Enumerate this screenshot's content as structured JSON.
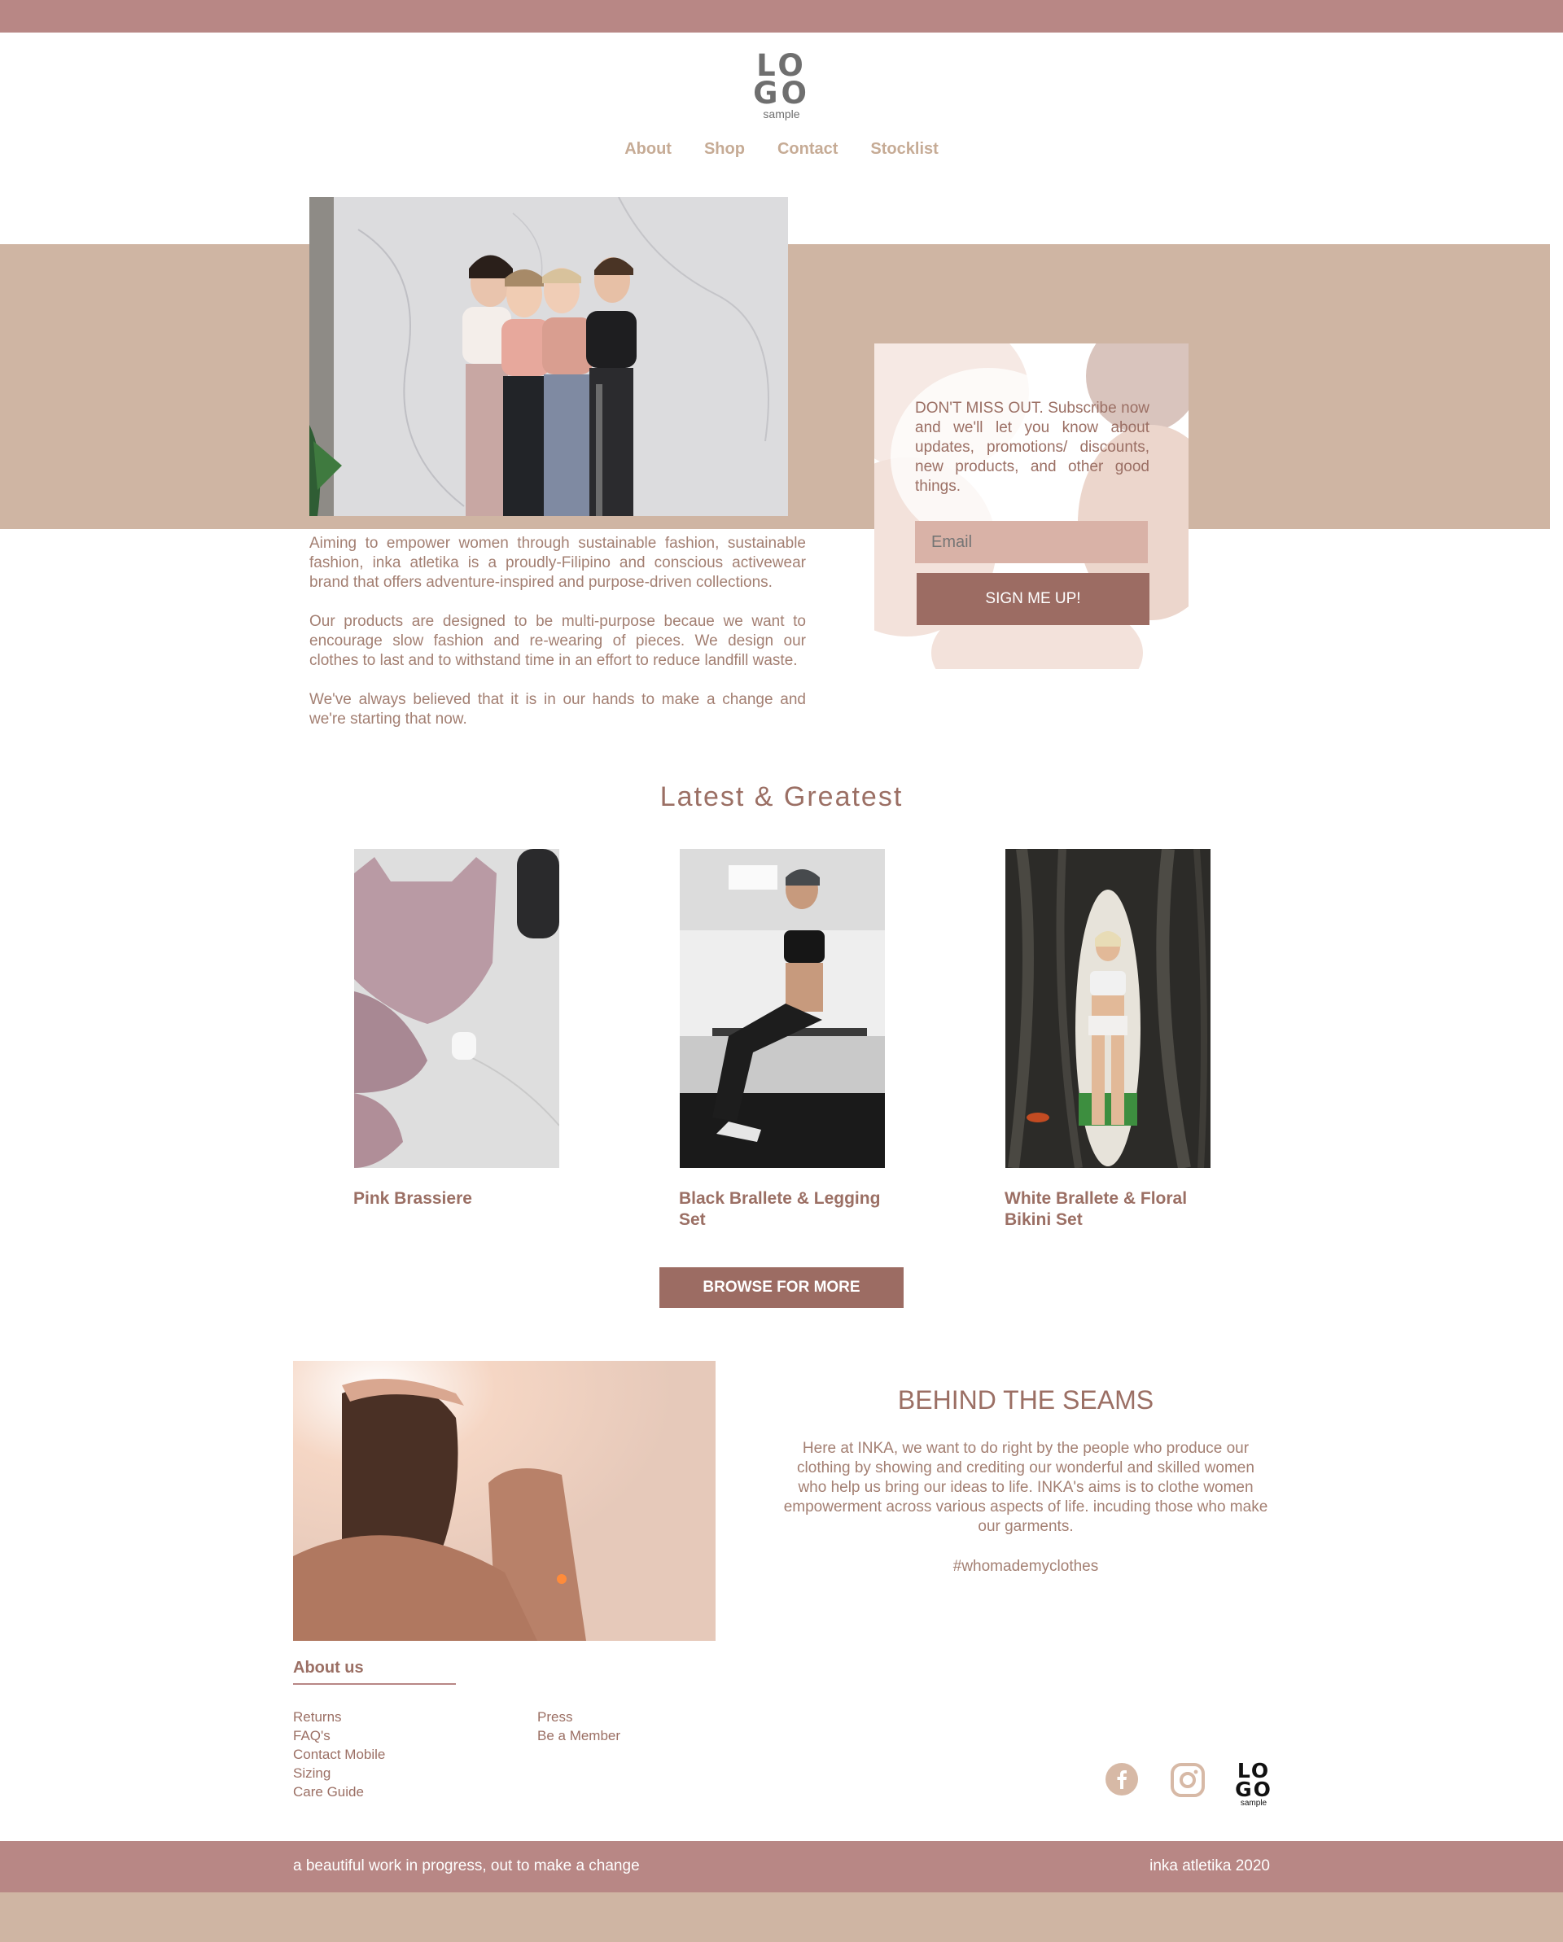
{
  "brand": {
    "logo_line1": "LO",
    "logo_line2": "GO",
    "logo_sub": "sample"
  },
  "nav": {
    "items": [
      {
        "label": "About"
      },
      {
        "label": "Shop"
      },
      {
        "label": "Contact"
      },
      {
        "label": "Stocklist"
      }
    ]
  },
  "newsletter": {
    "text": "DON'T MISS OUT. Subscribe now and we'll let you know about updates, promotions/ discounts, new products, and other good things.",
    "email_placeholder": "Email",
    "button_label": "SIGN ME UP!"
  },
  "intro": {
    "paragraphs": [
      "Aiming to empower women through sustainable fashion, sustainable fashion, inka atletika is a proudly-Filipino and conscious activewear brand that offers adventure-inspired and purpose-driven collections.",
      "Our products are designed to be multi-purpose becaue we want to encourage slow fashion and re-wearing of pieces. We design our clothes to last and to withstand time in an effort to reduce landfill waste.",
      "We've always believed that it is in our hands to make a change and we're starting that now."
    ]
  },
  "latest": {
    "title": "Latest & Greatest",
    "products": [
      {
        "name": "Pink Brassiere"
      },
      {
        "name": "Black Brallete & Legging Set"
      },
      {
        "name": "White Brallete & Floral Bikini Set"
      }
    ],
    "browse_label": "BROWSE FOR MORE"
  },
  "seams": {
    "title": "BEHIND THE SEAMS",
    "text": "Here at INKA, we want to do right by the people who produce our clothing by showing and crediting our wonderful and skilled women who help us bring our ideas to life. INKA's aims is to clothe women empowerment across various aspects of life. incuding those who make our garments.",
    "hashtag": "#whomademyclothes"
  },
  "footer": {
    "about_us": "About us",
    "col1": [
      "Returns",
      "FAQ's",
      "Contact Mobile",
      "Sizing",
      "Care Guide"
    ],
    "col2": [
      "Press",
      "Be a Member"
    ],
    "social": [
      "facebook-icon",
      "instagram-icon"
    ],
    "tagline": "a beautiful work in progress, out to make a change",
    "copyright": "inka atletika 2020"
  },
  "colors": {
    "rose": "#b88785",
    "sand": "#cfb5a3",
    "brown": "#9c6c63",
    "text": "#a37f72",
    "nav": "#c6ab95"
  }
}
